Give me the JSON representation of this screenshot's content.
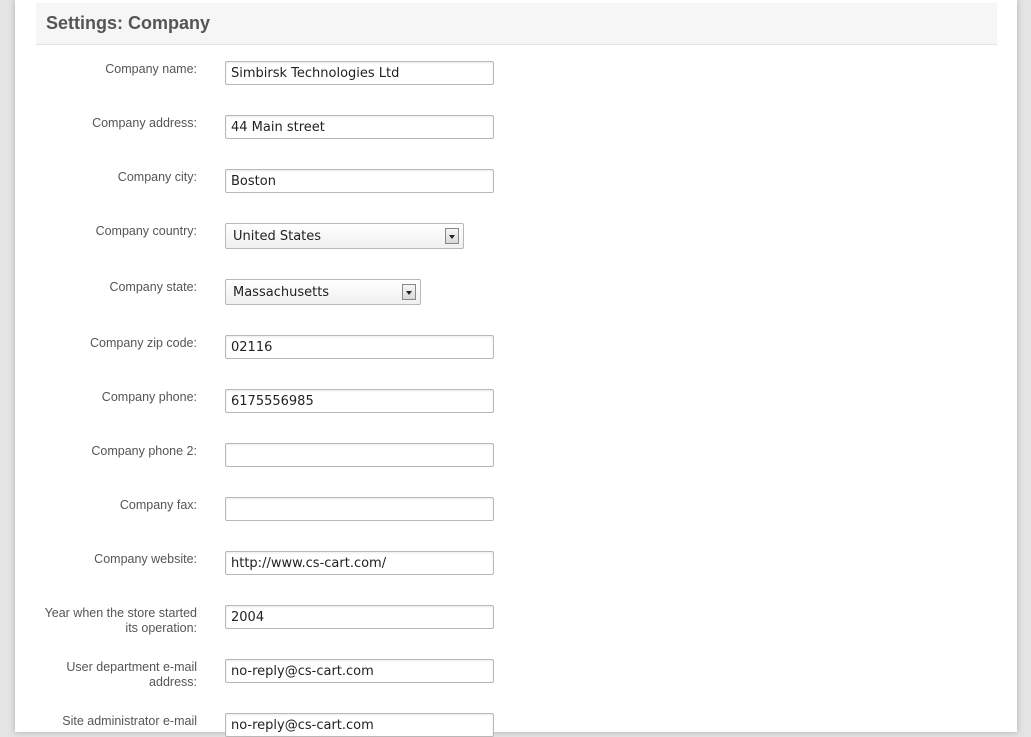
{
  "page": {
    "title": "Settings: Company"
  },
  "fields": {
    "company_name": {
      "label": "Company name:",
      "value": "Simbirsk Technologies Ltd"
    },
    "company_address": {
      "label": "Company address:",
      "value": "44 Main street"
    },
    "company_city": {
      "label": "Company city:",
      "value": "Boston"
    },
    "company_country": {
      "label": "Company country:",
      "value": "United States"
    },
    "company_state": {
      "label": "Company state:",
      "value": "Massachusetts"
    },
    "company_zip": {
      "label": "Company zip code:",
      "value": "02116"
    },
    "company_phone": {
      "label": "Company phone:",
      "value": "6175556985"
    },
    "company_phone_2": {
      "label": "Company phone 2:",
      "value": ""
    },
    "company_fax": {
      "label": "Company fax:",
      "value": ""
    },
    "company_website": {
      "label": "Company website:",
      "value": "http://www.cs-cart.com/"
    },
    "start_year": {
      "label_line1": "Year when the store started",
      "label_line2": "its operation:",
      "value": "2004"
    },
    "user_dept_email": {
      "label_line1": "User department e-mail",
      "label_line2": "address:",
      "value": "no-reply@cs-cart.com"
    },
    "site_admin_email": {
      "label_line1": "Site administrator e-mail",
      "value": "no-reply@cs-cart.com"
    }
  }
}
